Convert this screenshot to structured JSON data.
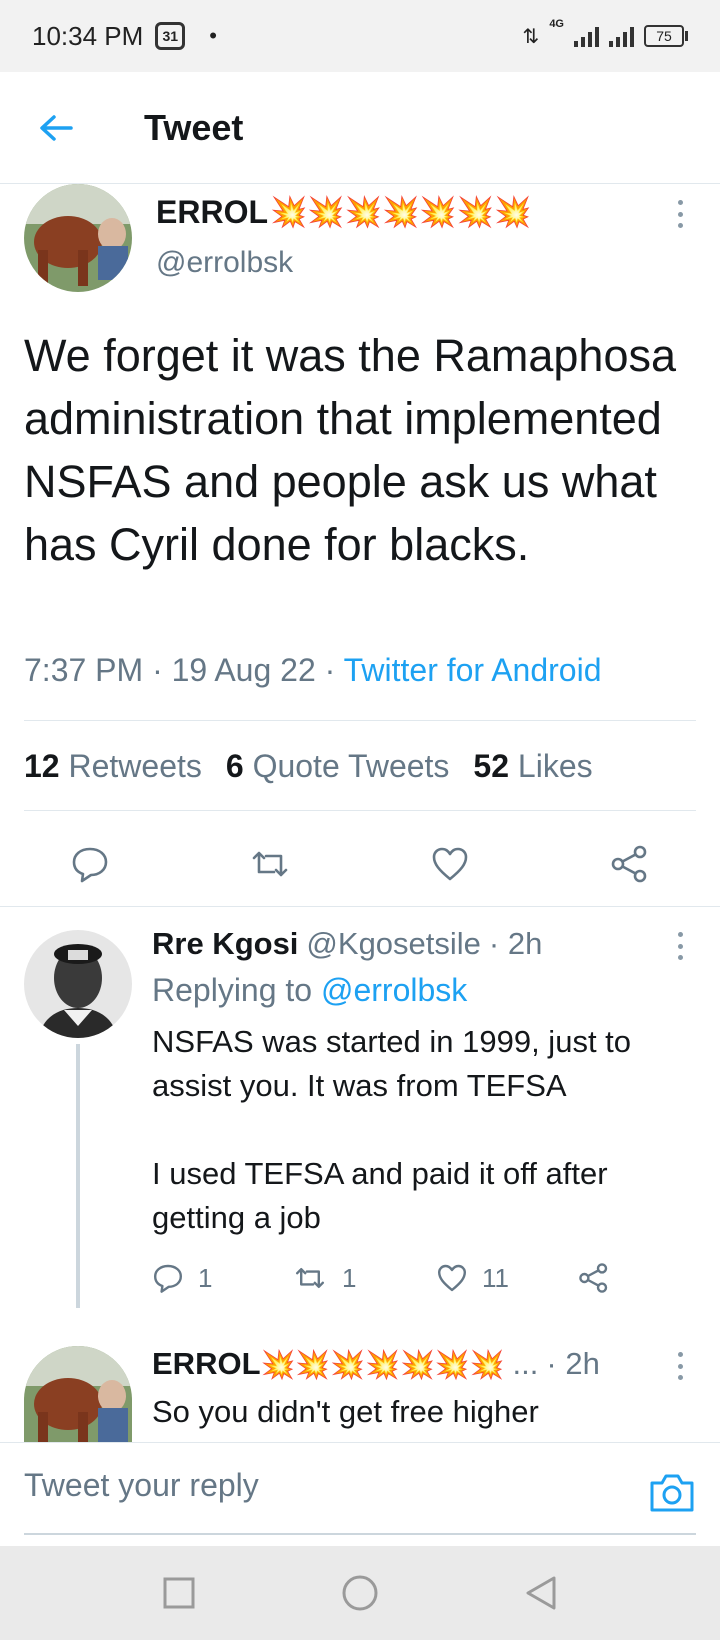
{
  "status_bar": {
    "time": "10:34 PM",
    "app_icon": "calendar-badge-icon",
    "dot": "•",
    "network": "4G",
    "battery": "75"
  },
  "header": {
    "title": "Tweet",
    "back_icon": "arrow-left-icon"
  },
  "main_tweet": {
    "author_name": "ERROL",
    "author_emoji": "💥💥💥💥💥💥💥",
    "handle": "@errolbsk",
    "text": "We forget it was the Ramaphosa administration that implemented NSFAS and people ask us what has Cyril done for blacks.",
    "time": "7:37 PM",
    "date": "19 Aug 22",
    "source": "Twitter for Android",
    "separator": " · ",
    "retweets_count": "12",
    "retweets_label": "Retweets",
    "quotes_count": "6",
    "quotes_label": "Quote Tweets",
    "likes_count": "52",
    "likes_label": "Likes"
  },
  "reply_1": {
    "name": "Rre Kgosi",
    "handle": "@Kgosetsile",
    "age": "· 2h",
    "replying_prefix": "Replying to ",
    "replying_handle": "@errolbsk",
    "text": "NSFAS was started in 1999, just to assist you. It was from TEFSA\n\nI used TEFSA and paid it off after getting a job",
    "reply_count": "1",
    "retweet_count": "1",
    "like_count": "11"
  },
  "reply_2": {
    "name": "ERROL",
    "emoji": "💥💥💥💥💥💥💥",
    "ellipsis": "...",
    "age": "· 2h",
    "text": "So you didn't get free higher"
  },
  "compose": {
    "placeholder": "Tweet your reply",
    "camera_icon": "camera-icon"
  },
  "colors": {
    "accent": "#1da1f2",
    "muted": "#657786",
    "text": "#14171a",
    "border": "#e1e8ed"
  }
}
